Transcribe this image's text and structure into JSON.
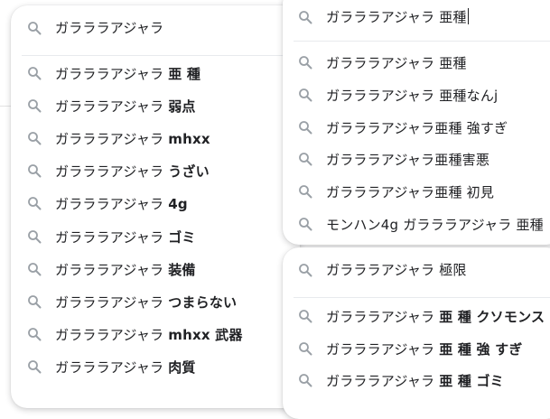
{
  "left_panel": {
    "query": "ガラララアジャラ",
    "search_icon": "search-icon",
    "suggestions": [
      {
        "base": "ガラララアジャラ ",
        "bold": "亜 種",
        "icon": "search-icon"
      },
      {
        "base": "ガラララアジャラ ",
        "bold": "弱点",
        "icon": "search-icon"
      },
      {
        "base": "ガラララアジャラ ",
        "bold": "mhxx",
        "icon": "search-icon"
      },
      {
        "base": "ガラララアジャラ ",
        "bold": "うざい",
        "icon": "search-icon"
      },
      {
        "base": "ガラララアジャラ ",
        "bold": "4g",
        "icon": "search-icon"
      },
      {
        "base": "ガラララアジャラ ",
        "bold": "ゴミ",
        "icon": "search-icon"
      },
      {
        "base": "ガラララアジャラ ",
        "bold": "装備",
        "icon": "search-icon"
      },
      {
        "base": "ガラララアジャラ ",
        "bold": "つまらない",
        "icon": "search-icon"
      },
      {
        "base": "ガラララアジャラ ",
        "bold": "mhxx 武器",
        "icon": "search-icon"
      },
      {
        "base": "ガラララアジャラ ",
        "bold": "肉質",
        "icon": "search-icon"
      }
    ]
  },
  "right_top_panel": {
    "query": "ガラララアジャラ 亜種",
    "search_icon": "search-icon",
    "suggestions": [
      {
        "base": "ガラララアジャラ 亜種",
        "bold": "",
        "icon": "search-icon"
      },
      {
        "base": "ガラララアジャラ 亜種なんj",
        "bold": "",
        "icon": "search-icon"
      },
      {
        "base": "ガラララアジャラ亜種 強すぎ",
        "bold": "",
        "icon": "search-icon"
      },
      {
        "base": "ガラララアジャラ亜種害悪",
        "bold": "",
        "icon": "search-icon"
      },
      {
        "base": "ガラララアジャラ亜種 初見",
        "bold": "",
        "icon": "search-icon"
      },
      {
        "base": "モンハン4g ガラララアジャラ 亜種",
        "bold": "",
        "icon": "search-icon"
      }
    ]
  },
  "right_bottom_panel": {
    "query": "ガラララアジャラ 極限",
    "search_icon": "search-icon",
    "suggestions": [
      {
        "base": "ガラララアジャラ ",
        "bold": "亜 種 クソモンス",
        "icon": "search-icon"
      },
      {
        "base": "ガラララアジャラ ",
        "bold": "亜 種 強 すぎ",
        "icon": "search-icon"
      },
      {
        "base": "ガラララアジャラ ",
        "bold": "亜 種 ゴミ",
        "icon": "search-icon"
      }
    ]
  }
}
